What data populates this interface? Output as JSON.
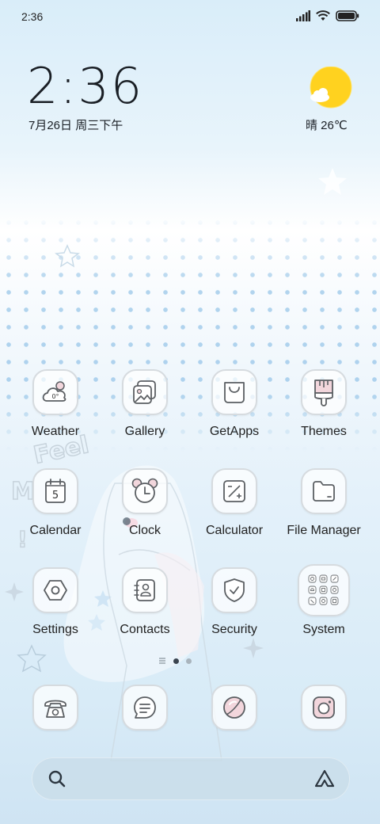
{
  "status_bar": {
    "time": "2:36",
    "icons": [
      "signal-icon",
      "wifi-icon",
      "battery-icon"
    ]
  },
  "clock_widget": {
    "time": "2:36",
    "date": "7月26日 周三下午",
    "weather_condition_icon": "sun-cloud-icon",
    "weather": "晴 26℃"
  },
  "wallpaper": {
    "text": "Feel"
  },
  "apps": [
    {
      "label": "Weather",
      "icon": "weather-icon",
      "badge": "0°"
    },
    {
      "label": "Gallery",
      "icon": "gallery-icon"
    },
    {
      "label": "GetApps",
      "icon": "getapps-icon"
    },
    {
      "label": "Themes",
      "icon": "themes-icon"
    },
    {
      "label": "Calendar",
      "icon": "calendar-icon",
      "badge": "5"
    },
    {
      "label": "Clock",
      "icon": "clock-icon"
    },
    {
      "label": "Calculator",
      "icon": "calculator-icon"
    },
    {
      "label": "File Manager",
      "icon": "folder-icon"
    },
    {
      "label": "Settings",
      "icon": "settings-icon"
    },
    {
      "label": "Contacts",
      "icon": "contacts-icon"
    },
    {
      "label": "Security",
      "icon": "security-icon"
    },
    {
      "label": "System",
      "icon": "system-folder-icon"
    }
  ],
  "pager": {
    "pages": 3,
    "current": 2
  },
  "dock": [
    {
      "icon": "phone-icon"
    },
    {
      "icon": "messages-icon"
    },
    {
      "icon": "browser-icon"
    },
    {
      "icon": "camera-icon"
    }
  ],
  "search_bar": {
    "left_icon": "search-icon",
    "right_icon": "assistant-icon"
  },
  "colors": {
    "sun": "#ffd21f",
    "icon_stroke": "#5b5f63",
    "icon_pink": "#f2d6dc"
  }
}
